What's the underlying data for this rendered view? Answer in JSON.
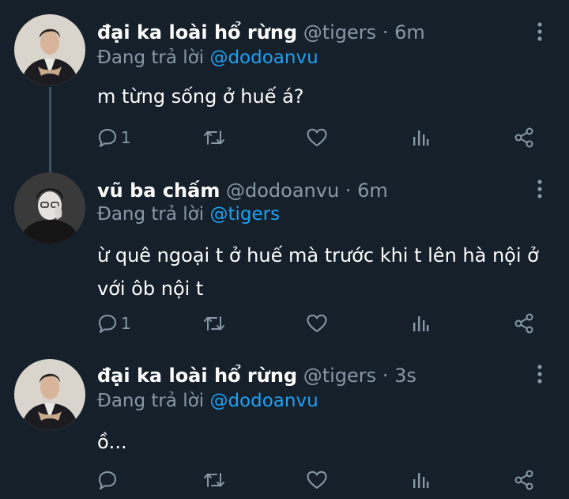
{
  "colors": {
    "background": "#15202b",
    "text_primary": "#ffffff",
    "text_secondary": "#8899a6",
    "mention": "#1da1f2",
    "thread_line": "#3d5466"
  },
  "action_icons": [
    "reply-icon",
    "retweet-icon",
    "like-icon",
    "analytics-icon",
    "share-icon"
  ],
  "tweets": [
    {
      "display_name": "đại ka loài hổ rừng",
      "handle": "@tigers",
      "separator": "·",
      "time": "6m",
      "reply_prefix": "Đang trả lời",
      "reply_to": "@dodoanvu",
      "text": "m từng sống ở huế á?",
      "reply_count": "1"
    },
    {
      "display_name": "vũ ba chấm",
      "handle": "@dodoanvu",
      "separator": "·",
      "time": "6m",
      "reply_prefix": "Đang trả lời",
      "reply_to": "@tigers",
      "text": "ừ quê ngoại t ở huế mà trước khi t lên hà nội ở với ôb nội t",
      "reply_count": "1"
    },
    {
      "display_name": "đại ka loài hổ rừng",
      "handle": "@tigers",
      "separator": "·",
      "time": "3s",
      "reply_prefix": "Đang trả lời",
      "reply_to": "@dodoanvu",
      "text": "ồ...",
      "reply_count": ""
    }
  ]
}
